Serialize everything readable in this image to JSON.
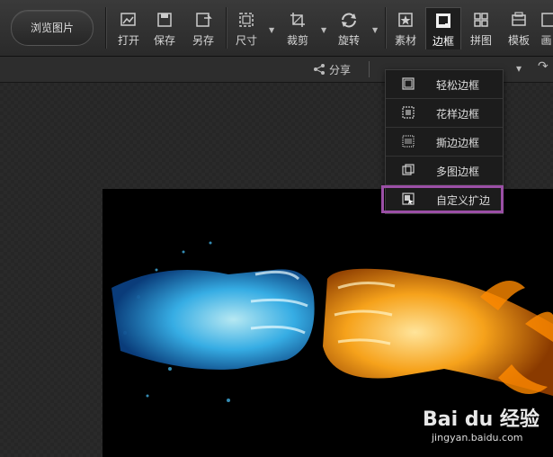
{
  "toolbar": {
    "browse_label": "浏览图片",
    "buttons": [
      {
        "label": "打开",
        "icon": "open-icon"
      },
      {
        "label": "保存",
        "icon": "save-icon"
      },
      {
        "label": "另存",
        "icon": "save-as-icon"
      },
      {
        "label": "尺寸",
        "icon": "resize-icon"
      },
      {
        "label": "裁剪",
        "icon": "crop-icon"
      },
      {
        "label": "旋转",
        "icon": "rotate-icon"
      },
      {
        "label": "素材",
        "icon": "material-icon"
      },
      {
        "label": "边框",
        "icon": "border-icon",
        "active": true
      },
      {
        "label": "拼图",
        "icon": "collage-icon"
      },
      {
        "label": "模板",
        "icon": "template-icon"
      },
      {
        "label": "画",
        "icon": "paint-icon"
      }
    ]
  },
  "subbar": {
    "share_label": "分享"
  },
  "border_menu": {
    "items": [
      {
        "label": "轻松边框",
        "icon": "easy-border-icon"
      },
      {
        "label": "花样边框",
        "icon": "pattern-border-icon"
      },
      {
        "label": "撕边边框",
        "icon": "torn-border-icon"
      },
      {
        "label": "多图边框",
        "icon": "multi-image-border-icon"
      },
      {
        "label": "自定义扩边",
        "icon": "custom-extend-icon",
        "highlighted": true
      }
    ]
  },
  "colors": {
    "highlight": "#9b4fa6",
    "toolbar_bg": "#2f2f2f",
    "menu_bg": "#1c1c1c"
  },
  "watermark": {
    "brand": "Bai du 经验",
    "url": "jingyan.baidu.com"
  }
}
